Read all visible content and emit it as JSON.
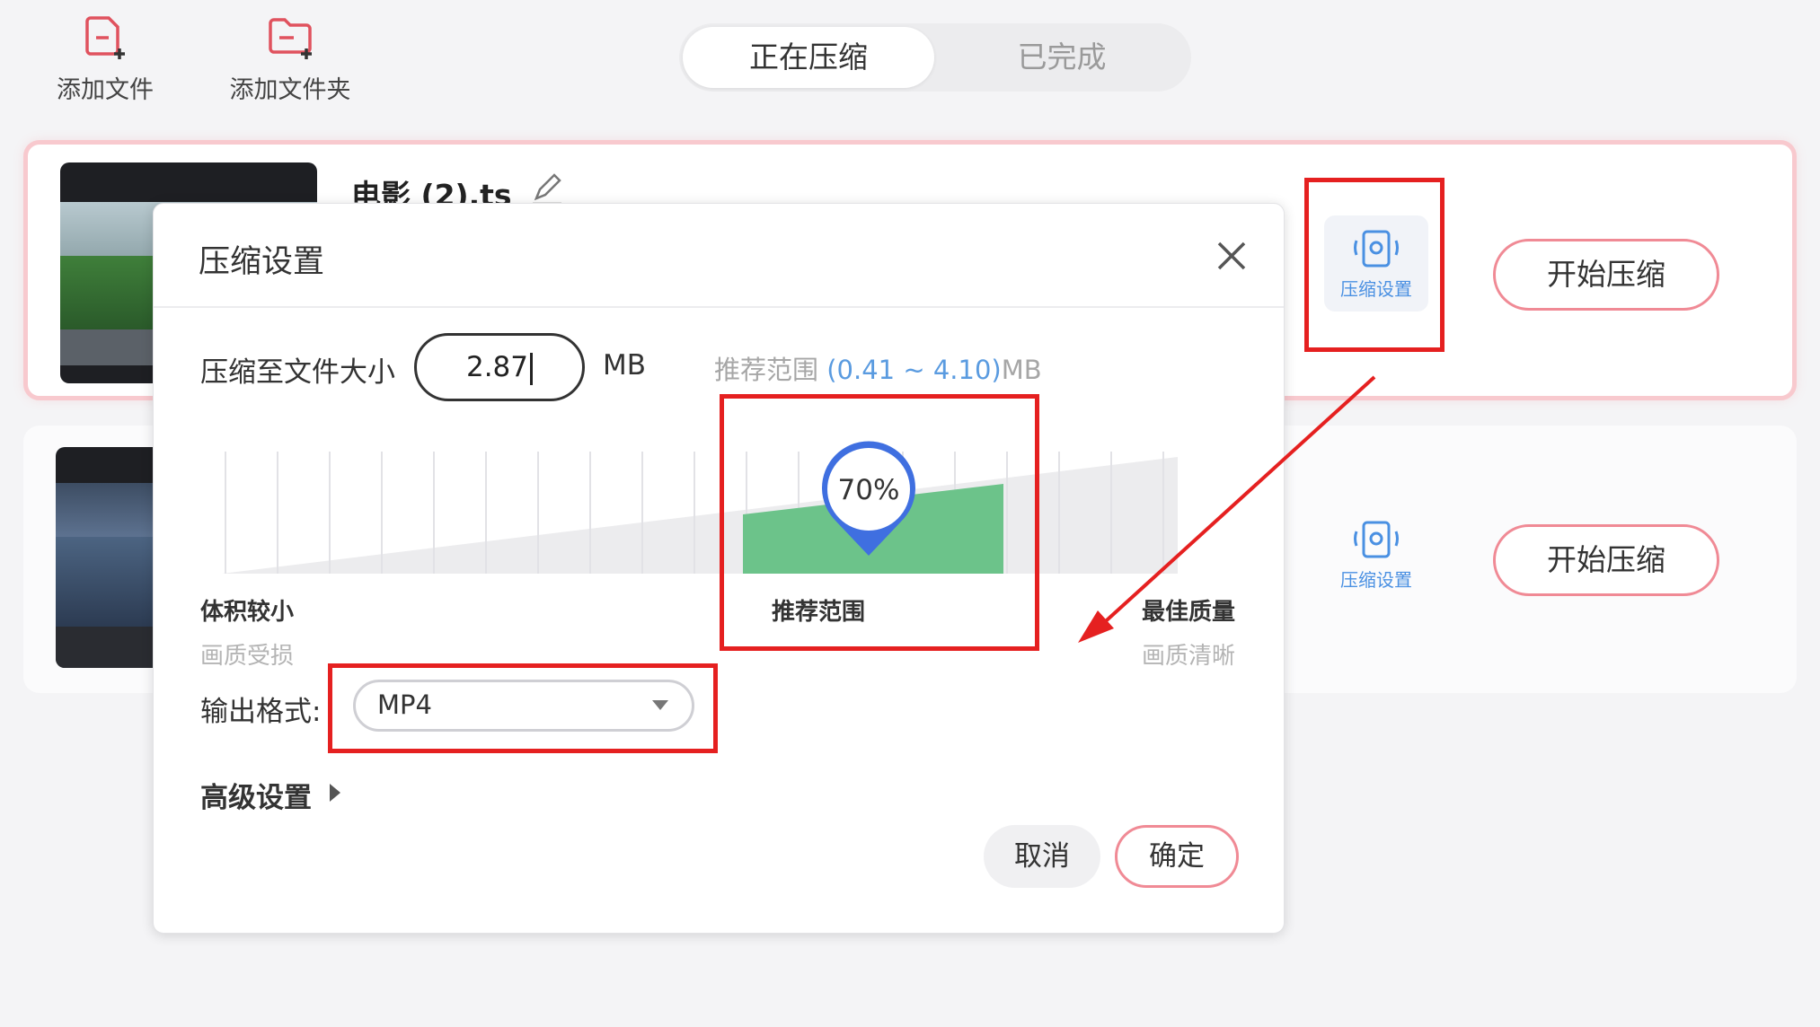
{
  "toolbar": {
    "add_file": "添加文件",
    "add_folder": "添加文件夹"
  },
  "tabs": {
    "compressing": "正在压缩",
    "done": "已完成"
  },
  "files": [
    {
      "name": "电影 (2).ts",
      "settings_label": "压缩设置",
      "start_label": "开始压缩"
    },
    {
      "name": "",
      "settings_label": "压缩设置",
      "start_label": "开始压缩"
    }
  ],
  "dialog": {
    "title": "压缩设置",
    "size_label": "压缩至文件大小",
    "size_value": "2.87",
    "size_unit": "MB",
    "recommend_prefix": "推荐范围 ",
    "recommend_range": "(0.41 ~ 4.10)",
    "recommend_unit": "MB",
    "slider": {
      "percent_label": "70%",
      "left_title": "体积较小",
      "left_sub": "画质受损",
      "center_title": "推荐范围",
      "right_title": "最佳质量",
      "right_sub": "画质清晰"
    },
    "format_label": "输出格式:",
    "format_value": "MP4",
    "advanced_label": "高级设置",
    "cancel_label": "取消",
    "ok_label": "确定"
  },
  "colors": {
    "accent_pink": "#f08a95",
    "link_blue": "#4a90e2",
    "highlight_red": "#e52020",
    "range_green": "#6cc38a",
    "marker_blue": "#3f6fe0"
  },
  "icons": {
    "add_file": "file-plus-icon",
    "add_folder": "folder-plus-icon",
    "edit": "pencil-icon",
    "settings": "compress-settings-icon",
    "close": "close-icon"
  }
}
